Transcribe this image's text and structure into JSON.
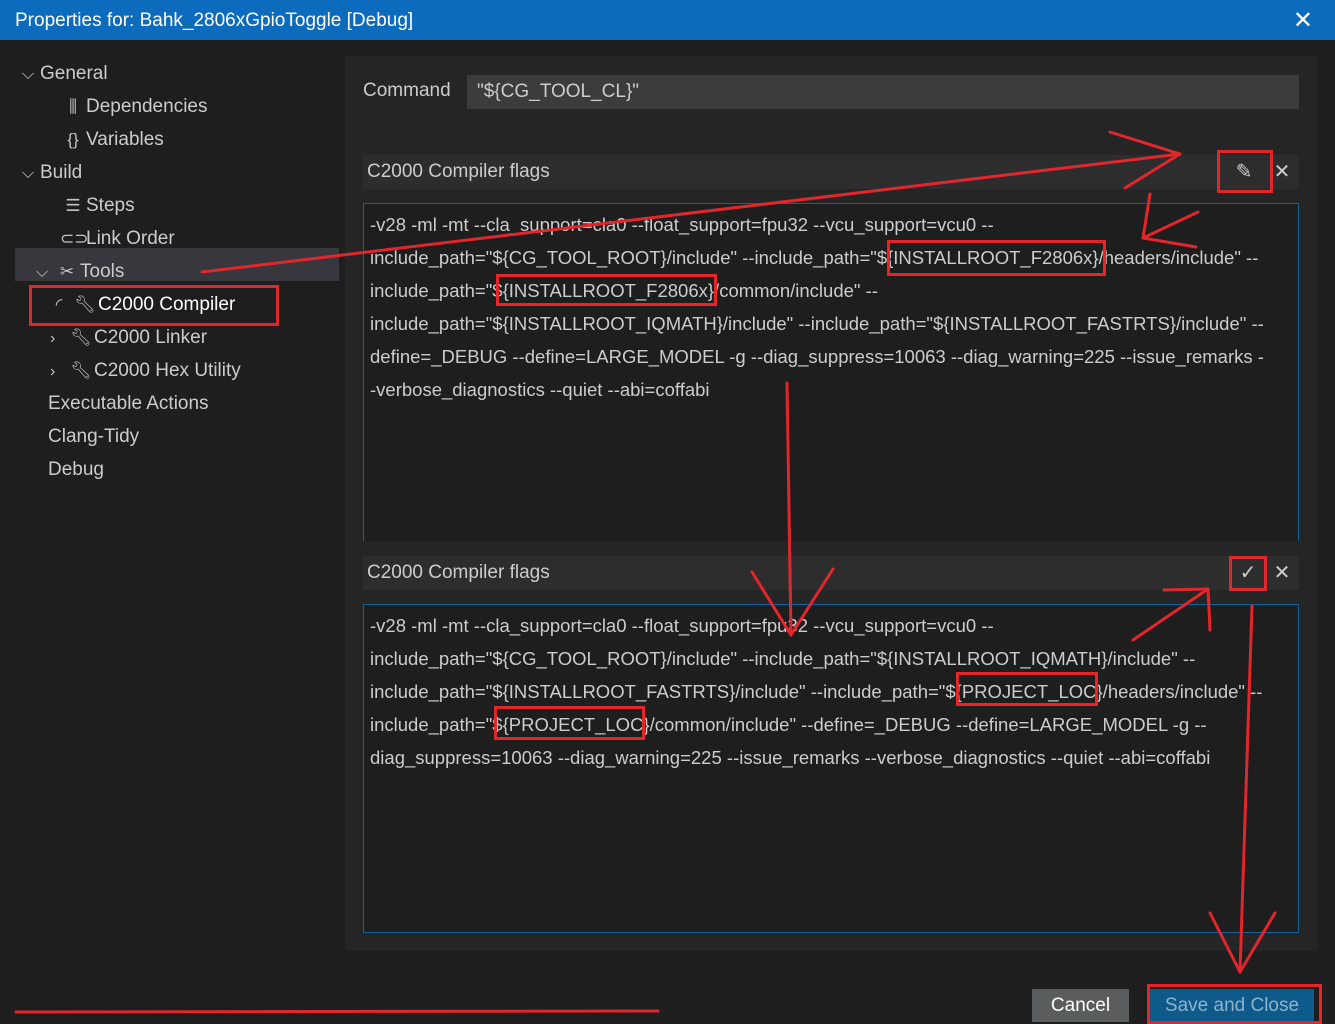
{
  "window": {
    "title": "Properties for: Bahk_2806xGpioToggle [Debug]",
    "close_glyph": "✕"
  },
  "sidebar": {
    "items": [
      {
        "label": "General",
        "icon": "chevron-down-icon"
      },
      {
        "label": "Dependencies",
        "icon": "library-icon"
      },
      {
        "label": "Variables",
        "icon": "braces-icon"
      },
      {
        "label": "Build",
        "icon": "chevron-down-icon"
      },
      {
        "label": "Steps",
        "icon": "list-icon"
      },
      {
        "label": "Link Order",
        "icon": "link-icon"
      },
      {
        "label": "Tools",
        "icon": "tools-icon"
      },
      {
        "label": "C2000 Compiler",
        "icon": "wrench-icon"
      },
      {
        "label": "C2000 Linker",
        "icon": "wrench-icon"
      },
      {
        "label": "C2000 Hex Utility",
        "icon": "wrench-icon"
      },
      {
        "label": "Executable Actions"
      },
      {
        "label": "Clang-Tidy"
      },
      {
        "label": "Debug"
      }
    ]
  },
  "command": {
    "label": "Command",
    "value": "\"${CG_TOOL_CL}\""
  },
  "flags_before": {
    "header": "C2000 Compiler flags",
    "edit_icon": "pencil-icon",
    "remove_icon": "close-icon",
    "lines": [
      "-v28 -ml -mt --cla_support=cla0 --float_support=fpu32 --vcu_support=vcu0 --",
      "include_path=\"${CG_TOOL_ROOT}/include\" --include_path=\"${INSTALLROOT_F2806x}/headers/include\" --",
      "include_path=\"${INSTALLROOT_F2806x}/common/include\" --",
      "include_path=\"${INSTALLROOT_IQMATH}/include\" --include_path=\"${INSTALLROOT_FASTRTS}/include\" --",
      "define=_DEBUG --define=LARGE_MODEL -g --diag_suppress=10063 --diag_warning=225 --issue_remarks -",
      "-verbose_diagnostics --quiet --abi=coffabi"
    ]
  },
  "flags_after": {
    "header": "C2000 Compiler flags",
    "confirm_icon": "check-icon",
    "remove_icon": "close-icon",
    "lines": [
      "-v28 -ml -mt --cla_support=cla0 --float_support=fpu32 --vcu_support=vcu0 --",
      "include_path=\"${CG_TOOL_ROOT}/include\" --include_path=\"${INSTALLROOT_IQMATH}/include\" --",
      "include_path=\"${INSTALLROOT_FASTRTS}/include\" --include_path=\"${PROJECT_LOC}/headers/include\" --",
      "include_path=\"${PROJECT_LOC}/common/include\" --define=_DEBUG --define=LARGE_MODEL -g --",
      "diag_suppress=10063 --diag_warning=225 --issue_remarks --verbose_diagnostics --quiet --abi=coffabi"
    ]
  },
  "footer": {
    "cancel_label": "Cancel",
    "save_label": "Save and Close"
  },
  "colors": {
    "titlebar": "#0c6bbd",
    "annotation": "#e3262b",
    "accent_border": "#0e639c"
  }
}
